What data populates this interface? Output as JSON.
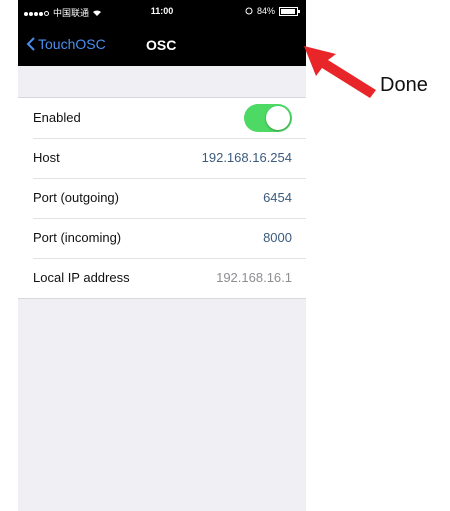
{
  "status_bar": {
    "carrier": "中国联通",
    "time": "11:00",
    "battery": "84%"
  },
  "nav": {
    "back_label": "TouchOSC",
    "title": "OSC"
  },
  "settings": {
    "enabled_label": "Enabled",
    "enabled_on": true,
    "host_label": "Host",
    "host_value": "192.168.16.254",
    "port_out_label": "Port (outgoing)",
    "port_out_value": "6454",
    "port_in_label": "Port (incoming)",
    "port_in_value": "8000",
    "local_ip_label": "Local IP address",
    "local_ip_value": "192.168.16.1"
  },
  "annotation": {
    "label": "Done",
    "arrow_color": "#e8262a"
  },
  "colors": {
    "toggle_on": "#4cd964",
    "ios_blue": "#4a8ff0"
  }
}
